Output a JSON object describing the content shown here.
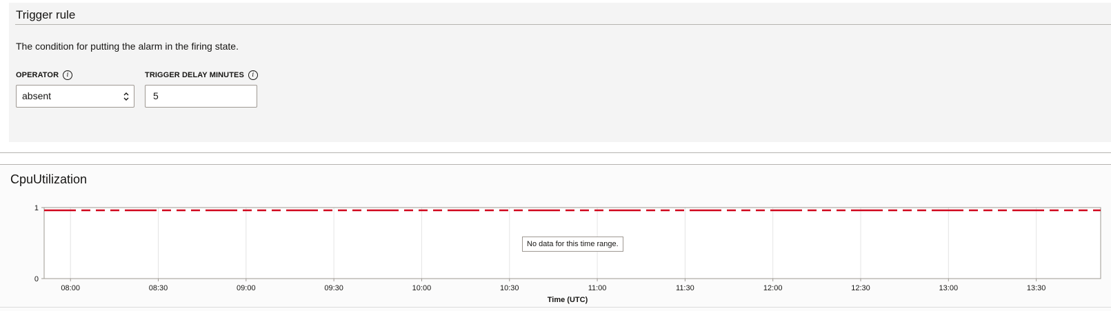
{
  "trigger": {
    "title": "Trigger rule",
    "description": "The condition for putting the alarm in the firing state.",
    "operator_label": "OPERATOR",
    "operator_value": "absent",
    "delay_label": "TRIGGER DELAY MINUTES",
    "delay_value": "5",
    "info_glyph": "i"
  },
  "chart": {
    "title": "CpuUtilization",
    "no_data_message": "No data for this time range.",
    "threshold_color": "#d0021b",
    "gridline_color": "#e4e4e4",
    "axis_color": "#9e9892"
  },
  "chart_data": {
    "type": "line",
    "title": "CpuUtilization",
    "xlabel": "Time (UTC)",
    "ylabel": "",
    "x_ticks": [
      "08:00",
      "08:30",
      "09:00",
      "09:30",
      "10:00",
      "10:30",
      "11:00",
      "11:30",
      "12:00",
      "12:30",
      "13:00",
      "13:30"
    ],
    "y_ticks": [
      "0",
      "1"
    ],
    "ylim": [
      0,
      1
    ],
    "xlim": [
      "07:51",
      "13:52"
    ],
    "grid": true,
    "series": [],
    "threshold": {
      "value": 1,
      "style": "dashed",
      "color": "#d0021b"
    },
    "annotation": "No data for this time range."
  }
}
